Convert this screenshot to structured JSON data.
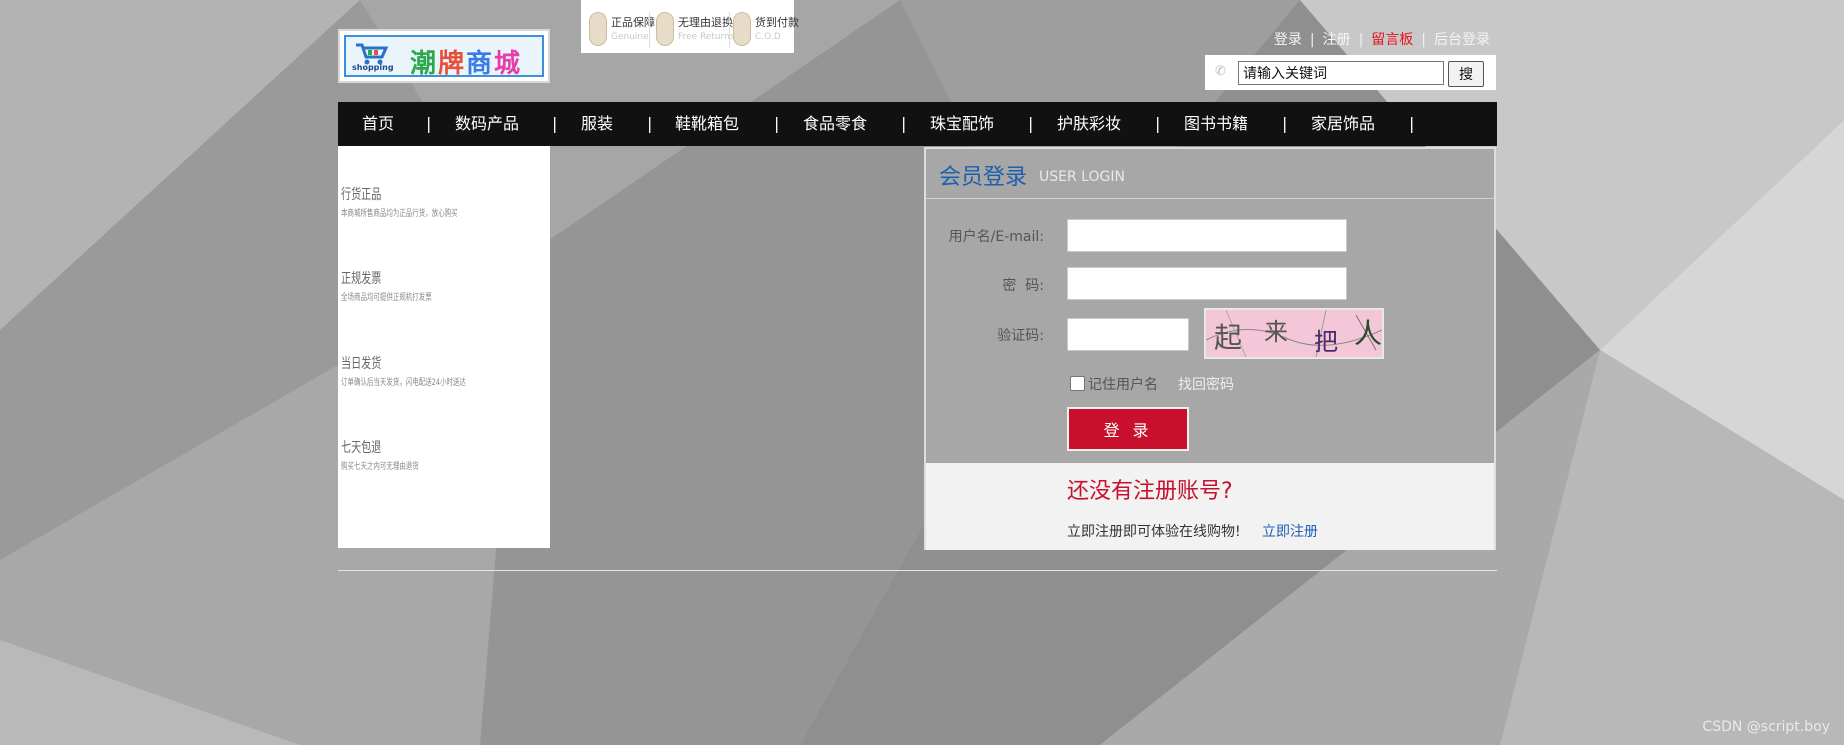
{
  "logo": {
    "text_shopping": "shopping",
    "brand_chars": [
      "潮",
      "牌",
      "商",
      "城"
    ]
  },
  "badges": [
    {
      "title": "正品保障",
      "sub": "Genuine",
      "icon": "shield-icon"
    },
    {
      "title": "无理由退换",
      "sub": "Free Returns",
      "icon": "return-icon"
    },
    {
      "title": "货到付款",
      "sub": "C.O.D",
      "icon": "cod-icon"
    }
  ],
  "toplinks": {
    "login": "登录",
    "register": "注册",
    "guestbook": "留言板",
    "admin_login": "后台登录",
    "separator": "|"
  },
  "search": {
    "value": "请输入关键词",
    "button": "搜",
    "phone_icon": "phone-icon"
  },
  "nav": {
    "items": [
      "首页",
      "数码产品",
      "服装",
      "鞋靴箱包",
      "食品零食",
      "珠宝配饰",
      "护肤彩妆",
      "图书书籍",
      "家居饰品"
    ],
    "separator": "|"
  },
  "side_features": [
    {
      "title": "行货正品",
      "desc": "本商城所售商品均为正品行货，放心购买"
    },
    {
      "title": "正规发票",
      "desc": "全场商品均可提供正规机打发票"
    },
    {
      "title": "当日发货",
      "desc": "订单确认后当天发货，闪电配送24小时送达"
    },
    {
      "title": "七天包退",
      "desc": "购买七天之内可无理由退货"
    }
  ],
  "login": {
    "title": "会员登录",
    "subtitle": "USER LOGIN",
    "username_label": "用户名/E-mail:",
    "password_label": "密  码:",
    "captcha_label": "验证码:",
    "captcha_chars": [
      "起",
      "来",
      "把",
      "人"
    ],
    "remember_label": "记住用户名",
    "forgot_label": "找回密码",
    "submit_label": "登 录",
    "register_prompt_title": "还没有注册账号?",
    "register_prompt_text": "立即注册即可体验在线购物!",
    "register_link": "立即注册"
  },
  "watermark": "CSDN @script.boy",
  "colors": {
    "accent_red": "#c8102e",
    "link_blue": "#1e5fb0",
    "nav_bg": "#111111",
    "hot_link": "#e8141e"
  }
}
